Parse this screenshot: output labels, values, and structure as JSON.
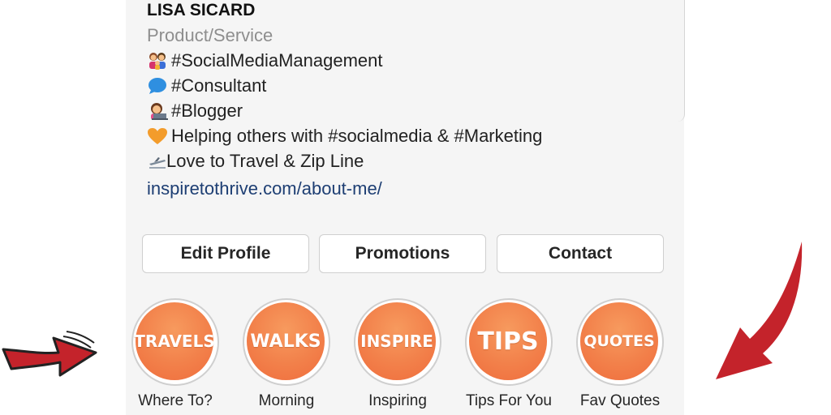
{
  "profile": {
    "name": "LISA SICARD",
    "category": "Product/Service",
    "bio_lines": [
      {
        "icon": "family-emoji-icon",
        "text": "#SocialMediaManagement"
      },
      {
        "icon": "speech-bubble-emoji-icon",
        "text": "#Consultant"
      },
      {
        "icon": "woman-laptop-emoji-icon",
        "text": "#Blogger"
      },
      {
        "icon": "orange-heart-emoji-icon",
        "text": "Helping others with #socialmedia & #Marketing"
      },
      {
        "icon": "airplane-emoji-icon",
        "text": "Love to Travel & Zip Line"
      }
    ],
    "link": "inspiretothrive.com/about-me/"
  },
  "buttons": {
    "edit_profile": "Edit Profile",
    "promotions": "Promotions",
    "contact": "Contact"
  },
  "highlights": [
    {
      "cover_text": "TRAVELS",
      "label": "Where To?"
    },
    {
      "cover_text": "WALKS",
      "label": "Morning"
    },
    {
      "cover_text": "INSPIRE",
      "label": "Inspiring"
    },
    {
      "cover_text": "TIPS",
      "label": "Tips For You"
    },
    {
      "cover_text": "QUOTES",
      "label": "Fav Quotes"
    }
  ],
  "colors": {
    "highlight_orange": "#f2804a",
    "arrow_red": "#c4232b",
    "link_blue": "#1d3e73"
  }
}
